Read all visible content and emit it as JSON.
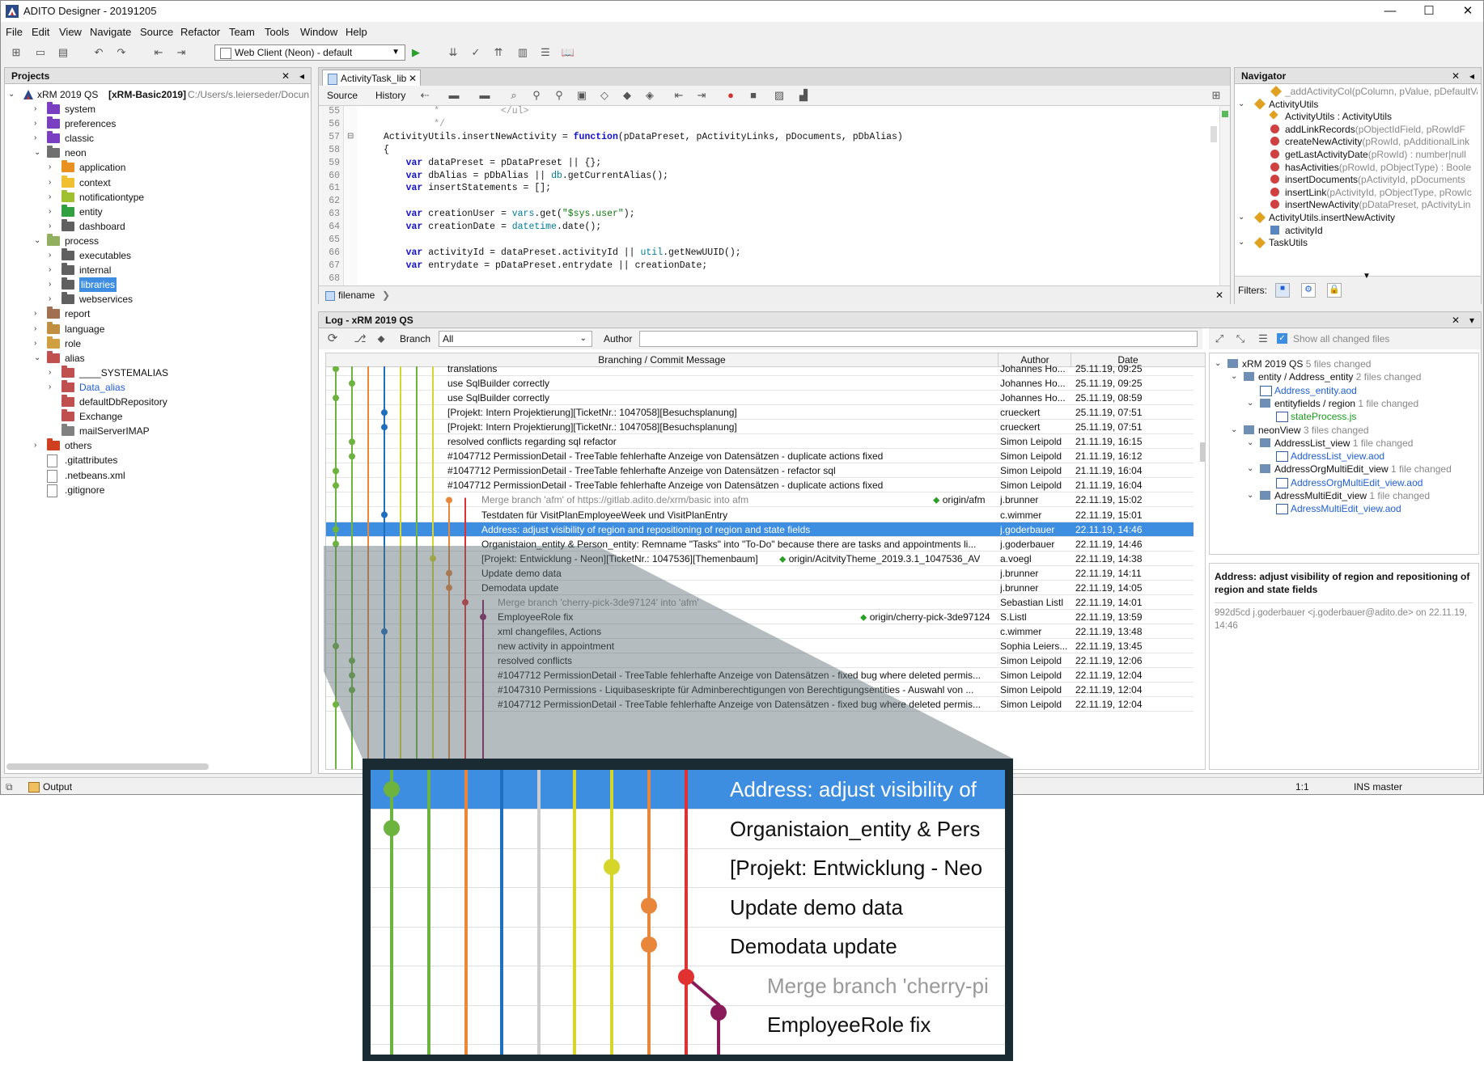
{
  "window": {
    "title": "ADITO Designer - 20191205",
    "min": "—",
    "max": "☐",
    "close": "✕"
  },
  "menu": [
    "File",
    "Edit",
    "View",
    "Navigate",
    "Source",
    "Refactor",
    "Team",
    "Tools",
    "Window",
    "Help"
  ],
  "toolbar": {
    "config_combo": "Web Client (Neon) - default"
  },
  "projects": {
    "title": "Projects",
    "root": {
      "name": "xRM 2019 QS",
      "bold_suffix": "[xRM-Basic2019]",
      "path": "C:/Users/s.leierseder/Docun"
    },
    "items": [
      {
        "label": "system",
        "depth": 1,
        "arrow": "›",
        "color": "#7a3fc0"
      },
      {
        "label": "preferences",
        "depth": 1,
        "arrow": "›",
        "color": "#7a3fc0"
      },
      {
        "label": "classic",
        "depth": 1,
        "arrow": "›",
        "color": "#7a3fc0"
      },
      {
        "label": "neon",
        "depth": 1,
        "arrow": "⌄",
        "color": "#707070"
      },
      {
        "label": "application",
        "depth": 2,
        "arrow": "›",
        "color": "#e89020"
      },
      {
        "label": "context",
        "depth": 2,
        "arrow": "›",
        "color": "#f0c030"
      },
      {
        "label": "notificationtype",
        "depth": 2,
        "arrow": "›",
        "color": "#a0c030"
      },
      {
        "label": "entity",
        "depth": 2,
        "arrow": "›",
        "color": "#30a040"
      },
      {
        "label": "dashboard",
        "depth": 2,
        "arrow": "›",
        "color": "#606060"
      },
      {
        "label": "process",
        "depth": 1,
        "arrow": "⌄",
        "color": "#90b060"
      },
      {
        "label": "executables",
        "depth": 2,
        "arrow": "›",
        "color": "#606060"
      },
      {
        "label": "internal",
        "depth": 2,
        "arrow": "›",
        "color": "#606060"
      },
      {
        "label": "libraries",
        "depth": 2,
        "arrow": "›",
        "color": "#606060",
        "selected": true
      },
      {
        "label": "webservices",
        "depth": 2,
        "arrow": "›",
        "color": "#606060"
      },
      {
        "label": "report",
        "depth": 1,
        "arrow": "›",
        "color": "#a07050"
      },
      {
        "label": "language",
        "depth": 1,
        "arrow": "›",
        "color": "#c09040"
      },
      {
        "label": "role",
        "depth": 1,
        "arrow": "›",
        "color": "#d0a040"
      },
      {
        "label": "alias",
        "depth": 1,
        "arrow": "⌄",
        "color": "#c05050"
      },
      {
        "label": "____SYSTEMALIAS",
        "depth": 2,
        "arrow": "›",
        "color": "#c05050"
      },
      {
        "label": "Data_alias",
        "depth": 2,
        "arrow": "›",
        "color": "#c05050",
        "link": true
      },
      {
        "label": "defaultDbRepository",
        "depth": 2,
        "arrow": "",
        "color": "#c05050"
      },
      {
        "label": "Exchange",
        "depth": 2,
        "arrow": "",
        "color": "#c05050"
      },
      {
        "label": "mailServerIMAP",
        "depth": 2,
        "arrow": "",
        "color": "#808080"
      },
      {
        "label": "others",
        "depth": 1,
        "arrow": "›",
        "color": "#d04020"
      },
      {
        "label": ".gitattributes",
        "depth": 1,
        "arrow": "",
        "color": "#ffffff"
      },
      {
        "label": ".netbeans.xml",
        "depth": 1,
        "arrow": "",
        "color": "#ffffff"
      },
      {
        "label": ".gitignore",
        "depth": 1,
        "arrow": "",
        "color": "#ffffff"
      }
    ]
  },
  "editor": {
    "tab": "ActivityTask_lib",
    "subtabs": [
      "Source",
      "History"
    ],
    "breadcrumb": "filename",
    "lines": [
      {
        "n": "55",
        "t": "         *           </ul>"
      },
      {
        "n": "56",
        "t": "         */"
      },
      {
        "n": "57",
        "t": "ActivityUtils.insertNewActivity = function(pDataPreset, pActivityLinks, pDocuments, pDbAlias)"
      },
      {
        "n": "58",
        "t": "{"
      },
      {
        "n": "59",
        "t": "    var dataPreset = pDataPreset || {};"
      },
      {
        "n": "60",
        "t": "    var dbAlias = pDbAlias || db.getCurrentAlias();"
      },
      {
        "n": "61",
        "t": "    var insertStatements = [];"
      },
      {
        "n": "62",
        "t": ""
      },
      {
        "n": "63",
        "t": "    var creationUser = vars.get(\"$sys.user\");"
      },
      {
        "n": "64",
        "t": "    var creationDate = datetime.date();"
      },
      {
        "n": "65",
        "t": ""
      },
      {
        "n": "66",
        "t": "    var activityId = dataPreset.activityId || util.getNewUUID();"
      },
      {
        "n": "67",
        "t": "    var entrydate = pDataPreset.entrydate || creationDate;"
      },
      {
        "n": "68",
        "t": ""
      }
    ]
  },
  "navigator": {
    "title": "Navigator",
    "items": [
      {
        "label": "_addActivityCol(pColumn, pValue, pDefaultVal",
        "depth": 2,
        "dim": true
      },
      {
        "label": "ActivityUtils",
        "depth": 1,
        "arrow": "⌄"
      },
      {
        "label": "ActivityUtils : ActivityUtils",
        "depth": 2,
        "kind": "ctor"
      },
      {
        "label": "addLinkRecords",
        "suffix": "(pObjectIdField, pRowIdF",
        "depth": 2,
        "kind": "method"
      },
      {
        "label": "createNewActivity",
        "suffix": "(pRowId, pAdditionalLink",
        "depth": 2,
        "kind": "method"
      },
      {
        "label": "getLastActivityDate",
        "suffix": "(pRowId) : number|null",
        "depth": 2,
        "kind": "method"
      },
      {
        "label": "hasActivities",
        "suffix": "(pRowId, pObjectType) : Boole",
        "depth": 2,
        "kind": "method"
      },
      {
        "label": "insertDocuments",
        "suffix": "(pActivityId, pDocuments",
        "depth": 2,
        "kind": "method"
      },
      {
        "label": "insertLink",
        "suffix": "(pActivityId, pObjectType, pRowIc",
        "depth": 2,
        "kind": "method"
      },
      {
        "label": "insertNewActivity",
        "suffix": "(pDataPreset, pActivityLin",
        "depth": 2,
        "kind": "method"
      },
      {
        "label": "ActivityUtils.insertNewActivity",
        "depth": 1,
        "arrow": "⌄"
      },
      {
        "label": "activityId",
        "depth": 2,
        "kind": "field"
      },
      {
        "label": "TaskUtils",
        "depth": 1,
        "arrow": "⌄"
      }
    ],
    "filters_label": "Filters:"
  },
  "log": {
    "title": "Log - xRM 2019 QS",
    "branch_label": "Branch",
    "branch_value": "All",
    "author_label": "Author",
    "show_all_label": "Show all changed files",
    "columns": [
      "Branching / Commit Message",
      "Author",
      "Date"
    ],
    "rows": [
      {
        "msg": "translations",
        "author": "Johannes Ho...",
        "date": "25.11.19, 09:25",
        "indent": 0,
        "partial": true
      },
      {
        "msg": "use SqlBuilder correctly",
        "author": "Johannes Ho...",
        "date": "25.11.19, 09:25",
        "indent": 0
      },
      {
        "msg": "use SqlBuilder correctly",
        "author": "Johannes Ho...",
        "date": "25.11.19, 08:59",
        "indent": 0
      },
      {
        "msg": "[Projekt: Intern Projektierung][TicketNr.: 1047058][Besuchsplanung]",
        "author": "crueckert",
        "date": "25.11.19, 07:51",
        "indent": 0
      },
      {
        "msg": "[Projekt: Intern Projektierung][TicketNr.: 1047058][Besuchsplanung]",
        "author": "crueckert",
        "date": "25.11.19, 07:51",
        "indent": 0
      },
      {
        "msg": "resolved conflicts regarding sql refactor",
        "author": "Simon Leipold",
        "date": "21.11.19, 16:15",
        "indent": 0
      },
      {
        "msg": "#1047712 PermissionDetail - TreeTable fehlerhafte Anzeige von Datensätzen - duplicate actions fixed",
        "author": "Simon Leipold",
        "date": "21.11.19, 16:12",
        "indent": 0
      },
      {
        "msg": "#1047712 PermissionDetail - TreeTable fehlerhafte Anzeige von Datensätzen - refactor sql",
        "author": "Simon Leipold",
        "date": "21.11.19, 16:04",
        "indent": 0
      },
      {
        "msg": "#1047712 PermissionDetail - TreeTable fehlerhafte Anzeige von Datensätzen - duplicate actions fixed",
        "author": "Simon Leipold",
        "date": "21.11.19, 16:04",
        "indent": 0
      },
      {
        "msg": "Merge branch 'afm' of https://gitlab.adito.de/xrm/basic into afm",
        "author": "j.brunner",
        "date": "22.11.19, 15:02",
        "indent": 1,
        "merge": true,
        "tag": "origin/afm"
      },
      {
        "msg": "Testdaten für VisitPlanEmployeeWeek und VisitPlanEntry",
        "author": "c.wimmer",
        "date": "22.11.19, 15:01",
        "indent": 1
      },
      {
        "msg": "Address: adjust visibility of region and repositioning of region and state fields",
        "author": "j.goderbauer",
        "date": "22.11.19, 14:46",
        "indent": 1,
        "selected": true
      },
      {
        "msg": "Organistaion_entity & Person_entity: Remname \"Tasks\" into \"To-Do\" because there are tasks and appointments li...",
        "author": "j.goderbauer",
        "date": "22.11.19, 14:46",
        "indent": 1
      },
      {
        "msg": "[Projekt: Entwicklung - Neon][TicketNr.: 1047536][Themenbaum]",
        "author": "a.voegl",
        "date": "22.11.19, 14:38",
        "indent": 1,
        "tag": "origin/AcitvityTheme_2019.3.1_1047536_AV"
      },
      {
        "msg": "Update demo data",
        "author": "j.brunner",
        "date": "22.11.19, 14:11",
        "indent": 1
      },
      {
        "msg": "Demodata update",
        "author": "j.brunner",
        "date": "22.11.19, 14:05",
        "indent": 1
      },
      {
        "msg": "Merge branch 'cherry-pick-3de97124' into 'afm'",
        "author": "Sebastian Listl",
        "date": "22.11.19, 14:01",
        "indent": 2,
        "merge": true
      },
      {
        "msg": "EmployeeRole fix",
        "author": "S.Listl",
        "date": "22.11.19, 13:59",
        "indent": 2,
        "tag": "origin/cherry-pick-3de97124"
      },
      {
        "msg": "xml changefiles, Actions",
        "author": "c.wimmer",
        "date": "22.11.19, 13:48",
        "indent": 2
      },
      {
        "msg": "new activity in appointment",
        "author": "Sophia Leiers...",
        "date": "22.11.19, 13:45",
        "indent": 2
      },
      {
        "msg": "resolved conflicts",
        "author": "Simon Leipold",
        "date": "22.11.19, 12:06",
        "indent": 2
      },
      {
        "msg": "#1047712 PermissionDetail - TreeTable fehlerhafte Anzeige von Datensätzen - fixed bug where deleted permis...",
        "author": "Simon Leipold",
        "date": "22.11.19, 12:04",
        "indent": 2
      },
      {
        "msg": "#1047310 Permissions - Liquibaseskripte für Adminberechtigungen von Berechtigungsentities - Auswahl von ...",
        "author": "Simon Leipold",
        "date": "22.11.19, 12:04",
        "indent": 2
      },
      {
        "msg": "#1047712 PermissionDetail - TreeTable fehlerhafte Anzeige von Datensätzen - fixed bug where deleted permis...",
        "author": "Simon Leipold",
        "date": "22.11.19, 12:04",
        "indent": 2,
        "partial": true
      }
    ]
  },
  "changes": {
    "items": [
      {
        "label": "xRM 2019 QS",
        "note": "5 files changed",
        "depth": 0
      },
      {
        "label": "entity / Address_entity",
        "note": "2 files changed",
        "depth": 1
      },
      {
        "label": "Address_entity.aod",
        "depth": 2,
        "link": true
      },
      {
        "label": "entityfields / region",
        "note": "1 file changed",
        "depth": 2
      },
      {
        "label": "stateProcess.js",
        "depth": 3,
        "green": true
      },
      {
        "label": "neonView",
        "note": "3 files changed",
        "depth": 1
      },
      {
        "label": "AddressList_view",
        "note": "1 file changed",
        "depth": 2
      },
      {
        "label": "AddressList_view.aod",
        "depth": 3,
        "link": true
      },
      {
        "label": "AddressOrgMultiEdit_view",
        "note": "1 file changed",
        "depth": 2
      },
      {
        "label": "AddressOrgMultiEdit_view.aod",
        "depth": 3,
        "link": true
      },
      {
        "label": "AdressMultiEdit_view",
        "note": "1 file changed",
        "depth": 2
      },
      {
        "label": "AdressMultiEdit_view.aod",
        "depth": 3,
        "link": true
      }
    ],
    "detail_title": "Address: adjust visibility of region and repositioning of region and state fields",
    "detail_meta": "992d5cd j.goderbauer <j.goderbauer@adito.de> on 22.11.19, 14:46"
  },
  "statusbar": {
    "output": "Output",
    "pos": "1:1",
    "mode": "INS master"
  },
  "zoom": {
    "rows": [
      "Address: adjust visibility of",
      "Organistaion_entity & Pers",
      "[Projekt: Entwicklung - Neo",
      "Update demo data",
      "Demodata update",
      "Merge branch 'cherry-pi",
      "EmployeeRole fix"
    ]
  },
  "colors": {
    "accent": "#3d8ee0",
    "selection": "#3d8ee0",
    "lane_green": "#6db33f",
    "lane_blue": "#1f6fbf",
    "lane_orange": "#e8873a",
    "lane_yellow": "#d6d62a",
    "lane_red": "#e03030",
    "lane_purple": "#8a1a5a"
  }
}
